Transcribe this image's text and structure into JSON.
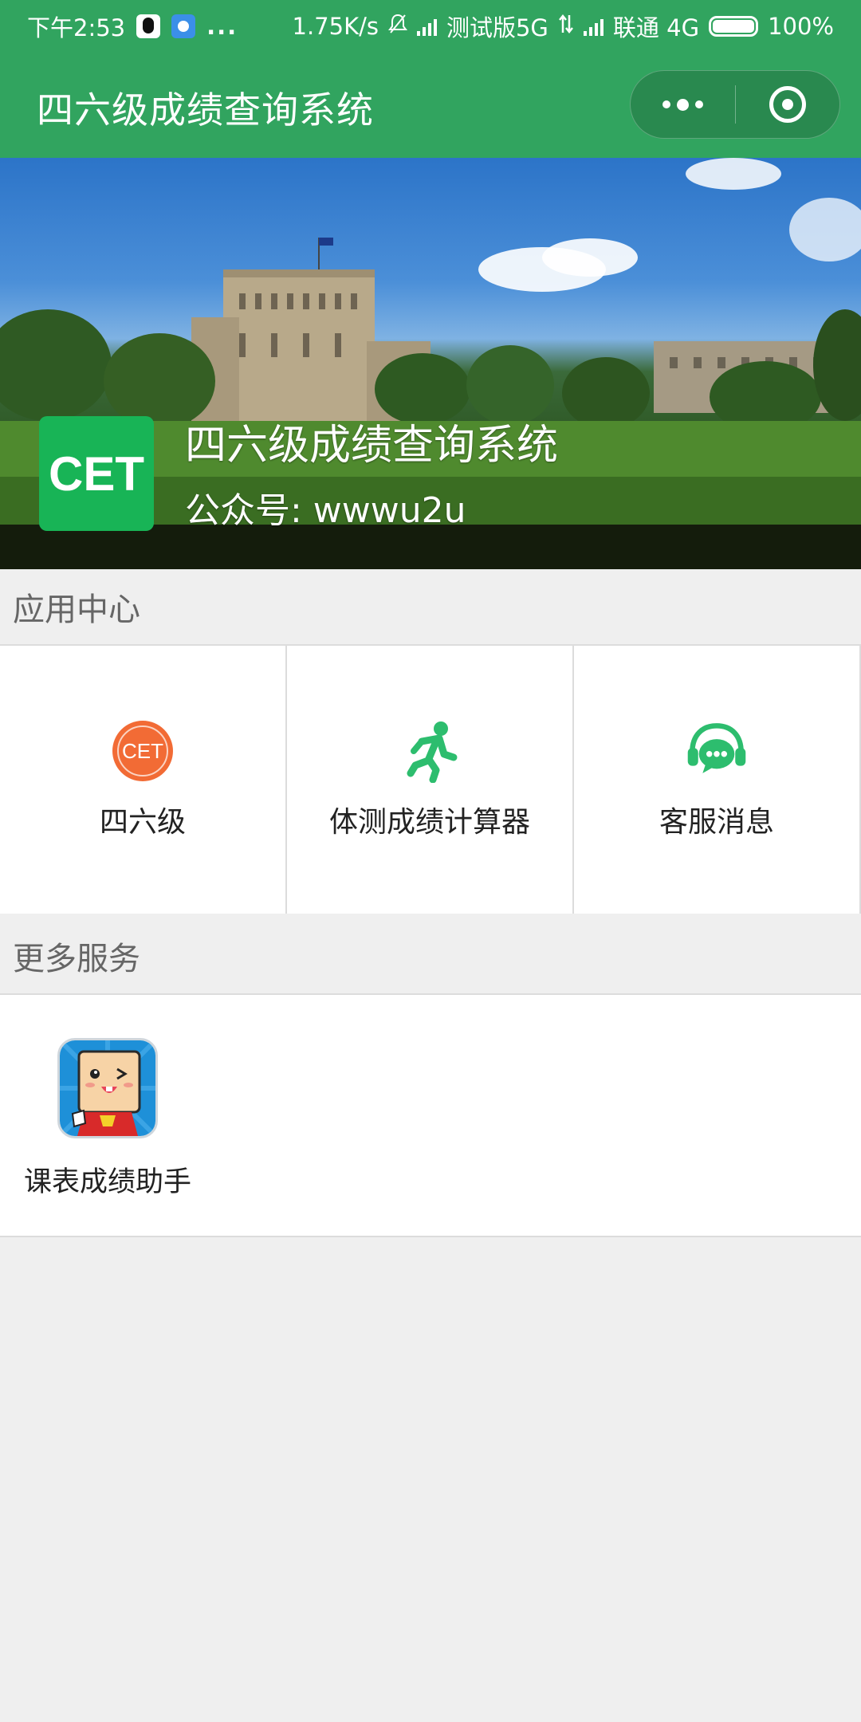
{
  "status_bar": {
    "time": "下午2:53",
    "apps": [
      "qq-icon",
      "browser-icon"
    ],
    "more": "...",
    "speed": "1.75K/s",
    "carrier1": "测试版5G",
    "carrier2": "联通 4G",
    "battery": "100%",
    "battery_level": 1.0
  },
  "navbar": {
    "title": "四六级成绩查询系统",
    "capsule": [
      "more-icon",
      "close-miniprogram-icon"
    ]
  },
  "banner": {
    "logo_text": "CET",
    "title": "四六级成绩查询系统",
    "subtitle": "公众号: wwwu2u",
    "colors": {
      "logo_bg": "#18b456"
    }
  },
  "app_center": {
    "header": "应用中心",
    "items": [
      {
        "label": "四六级",
        "icon": "cet-badge-icon"
      },
      {
        "label": "体测成绩计算器",
        "icon": "running-person-icon"
      },
      {
        "label": "客服消息",
        "icon": "headset-chat-icon"
      }
    ]
  },
  "more_services": {
    "header": "更多服务",
    "items": [
      {
        "label": "课表成绩助手",
        "icon": "mascot-icon"
      }
    ]
  },
  "colors": {
    "brand_green": "#31a45f",
    "icon_green": "#2dbd6e",
    "cet_orange": "#f26b35",
    "background": "#efefef"
  }
}
